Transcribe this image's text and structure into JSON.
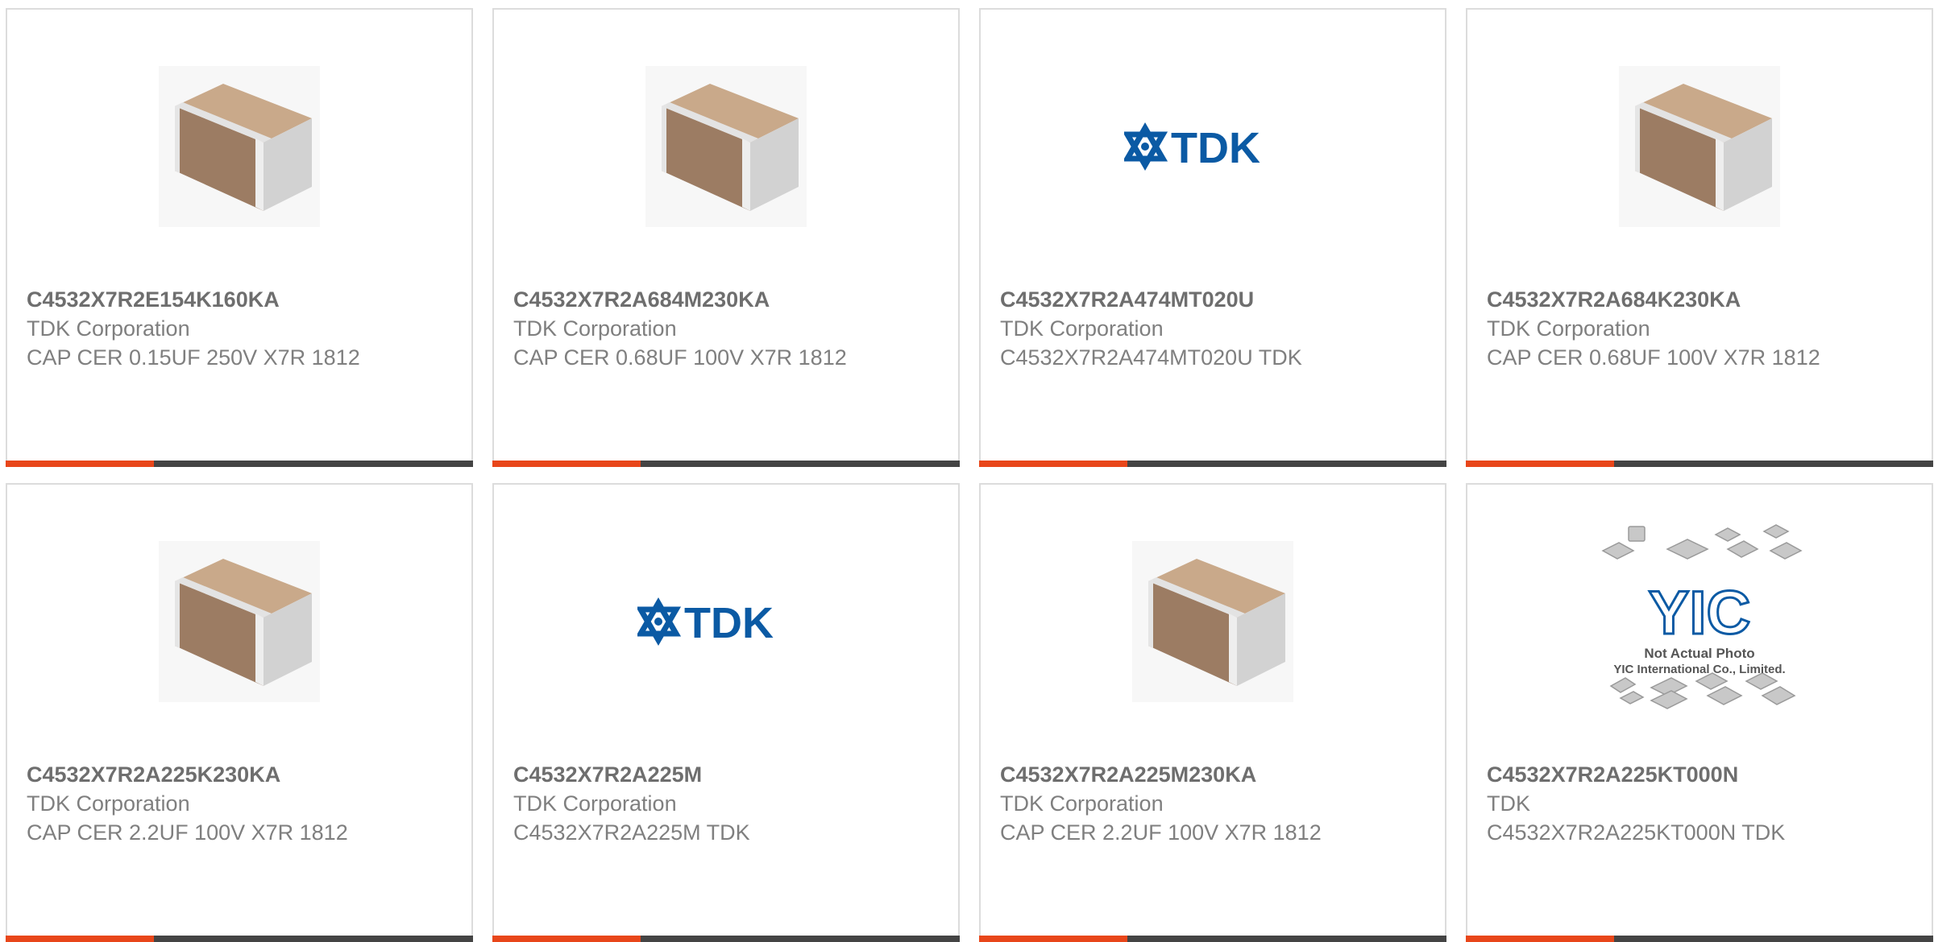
{
  "colors": {
    "accent": "#e8461a",
    "bar": "#444444",
    "tdk_blue": "#0b5aa4"
  },
  "cards": [
    {
      "part_number": "C4532X7R2E154K160KA",
      "manufacturer": "TDK Corporation",
      "description": "CAP CER 0.15UF 250V X7R 1812",
      "image": "capacitor-chip-image"
    },
    {
      "part_number": "C4532X7R2A684M230KA",
      "manufacturer": "TDK Corporation",
      "description": "CAP CER 0.68UF 100V X7R 1812",
      "image": "capacitor-chip-image"
    },
    {
      "part_number": "C4532X7R2A474MT020U",
      "manufacturer": "TDK Corporation",
      "description": "C4532X7R2A474MT020U TDK",
      "image": "tdk-logo",
      "logo_text": "TDK"
    },
    {
      "part_number": "C4532X7R2A684K230KA",
      "manufacturer": "TDK Corporation",
      "description": "CAP CER 0.68UF 100V X7R 1812",
      "image": "capacitor-chip-image"
    },
    {
      "part_number": "C4532X7R2A225K230KA",
      "manufacturer": "TDK Corporation",
      "description": "CAP CER 2.2UF 100V X7R 1812",
      "image": "capacitor-chip-image"
    },
    {
      "part_number": "C4532X7R2A225M",
      "manufacturer": "TDK Corporation",
      "description": "C4532X7R2A225M TDK",
      "image": "tdk-logo",
      "logo_text": "TDK"
    },
    {
      "part_number": "C4532X7R2A225M230KA",
      "manufacturer": "TDK Corporation",
      "description": "CAP CER 2.2UF 100V X7R 1812",
      "image": "capacitor-chip-image"
    },
    {
      "part_number": "C4532X7R2A225KT000N",
      "manufacturer": "TDK",
      "description": "C4532X7R2A225KT000N TDK",
      "image": "yic-placeholder-image",
      "placeholder_logo": "YIC",
      "placeholder_line1": "Not Actual Photo",
      "placeholder_line2": "YIC International Co., Limited."
    }
  ]
}
